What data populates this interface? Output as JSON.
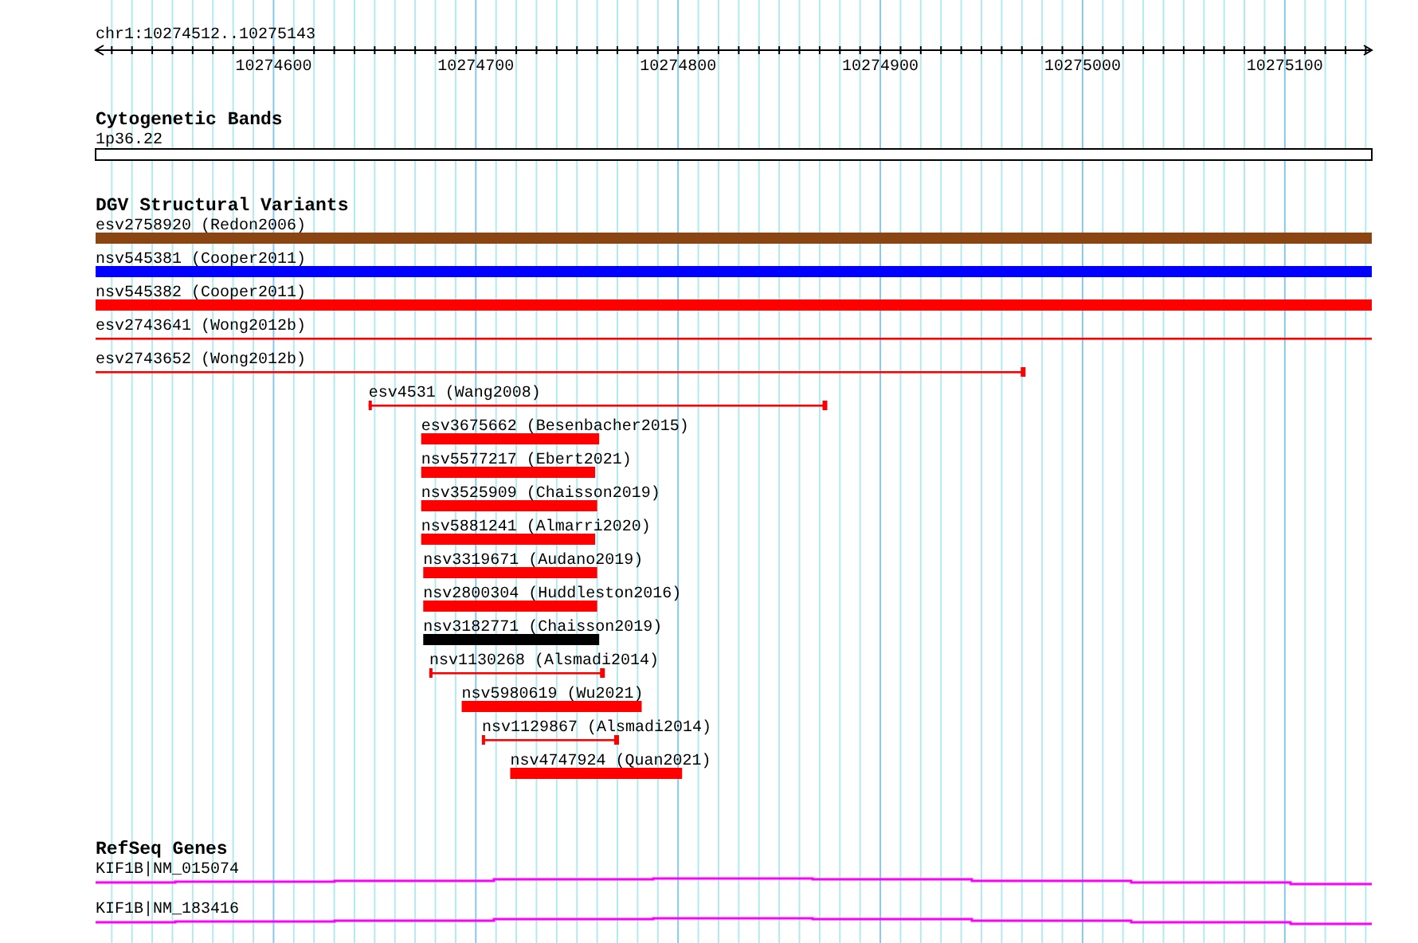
{
  "ruler": {
    "location": "chr1:10274512..10275143",
    "ticks": [
      {
        "label": "10274600"
      },
      {
        "label": "10274700"
      },
      {
        "label": "10274800"
      },
      {
        "label": "10274900"
      },
      {
        "label": "10275000"
      },
      {
        "label": "10275100"
      }
    ]
  },
  "tracks": [
    {
      "title": "Cytogenetic Bands",
      "kind": "cytoband",
      "features": [
        {
          "label": "1p36.22"
        }
      ]
    },
    {
      "title": "DGV Structural Variants",
      "kind": "variants",
      "features": [
        {
          "label": "esv2758920 (Redon2006)",
          "kind": "bar",
          "color": "#8b4513"
        },
        {
          "label": "nsv545381 (Cooper2011)",
          "kind": "bar",
          "color": "#0000ff"
        },
        {
          "label": "nsv545382 (Cooper2011)",
          "kind": "bar",
          "color": "#ff0000"
        },
        {
          "label": "esv2743641 (Wong2012b)",
          "kind": "line",
          "color": "#ff0000"
        },
        {
          "label": "esv2743652 (Wong2012b)",
          "kind": "line",
          "color": "#ff0000"
        },
        {
          "label": "esv4531 (Wang2008)",
          "kind": "line",
          "color": "#ff0000"
        },
        {
          "label": "esv3675662 (Besenbacher2015)",
          "kind": "bar",
          "color": "#ff0000"
        },
        {
          "label": "nsv5577217 (Ebert2021)",
          "kind": "bar",
          "color": "#ff0000"
        },
        {
          "label": "nsv3525909 (Chaisson2019)",
          "kind": "bar",
          "color": "#ff0000"
        },
        {
          "label": "nsv5881241 (Almarri2020)",
          "kind": "bar",
          "color": "#ff0000"
        },
        {
          "label": "nsv3319671 (Audano2019)",
          "kind": "bar",
          "color": "#ff0000"
        },
        {
          "label": "nsv2800304 (Huddleston2016)",
          "kind": "bar",
          "color": "#ff0000"
        },
        {
          "label": "nsv3182771 (Chaisson2019)",
          "kind": "bar",
          "color": "#000000"
        },
        {
          "label": "nsv1130268 (Alsmadi2014)",
          "kind": "line",
          "color": "#ff0000"
        },
        {
          "label": "nsv5980619 (Wu2021)",
          "kind": "bar",
          "color": "#ff0000"
        },
        {
          "label": "nsv1129867 (Alsmadi2014)",
          "kind": "line",
          "color": "#ff0000"
        },
        {
          "label": "nsv4747924 (Quan2021)",
          "kind": "bar",
          "color": "#ff0000"
        }
      ]
    },
    {
      "title": "RefSeq Genes",
      "kind": "genes",
      "features": [
        {
          "label": "KIF1B|NM_015074"
        },
        {
          "label": "KIF1B|NM_183416"
        }
      ]
    }
  ]
}
